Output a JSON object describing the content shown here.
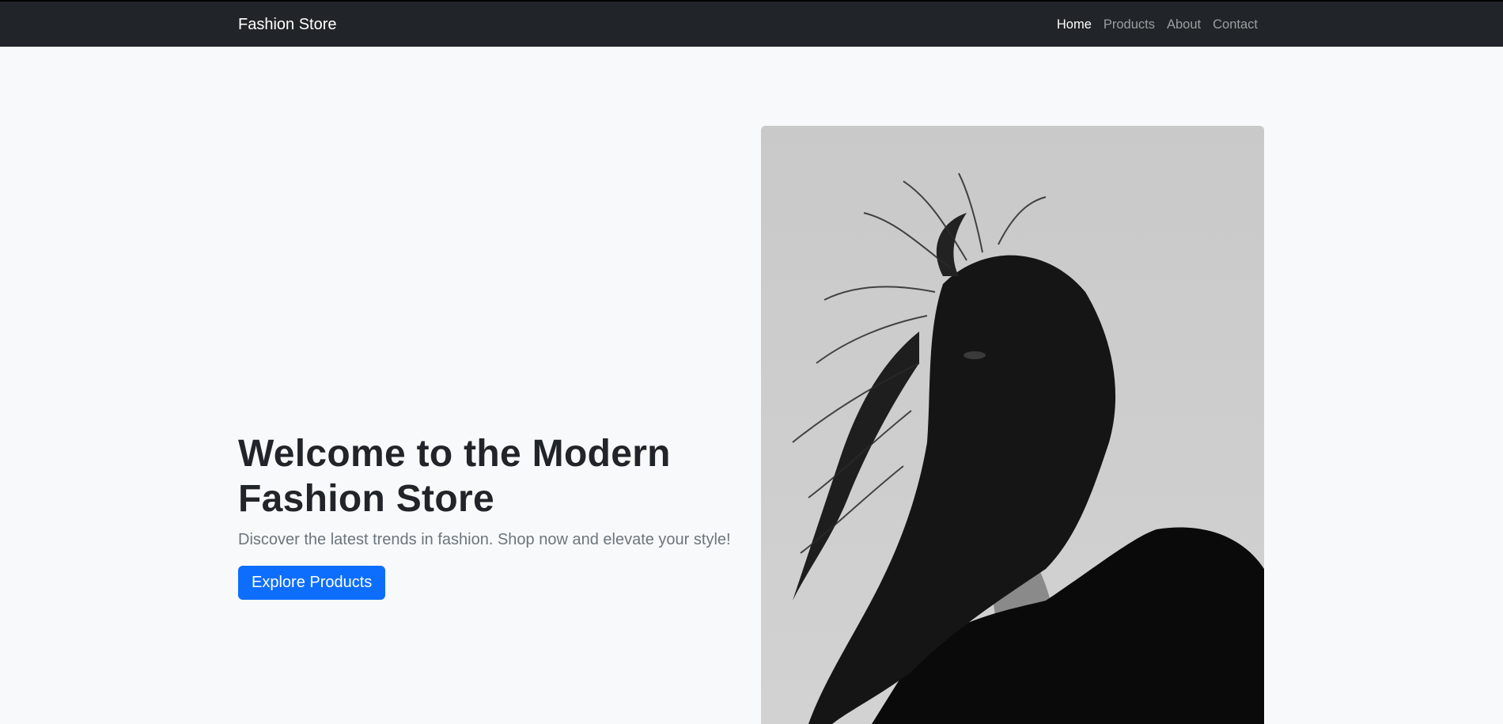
{
  "navbar": {
    "brand": "Fashion Store",
    "links": [
      {
        "label": "Home",
        "active": true
      },
      {
        "label": "Products",
        "active": false
      },
      {
        "label": "About",
        "active": false
      },
      {
        "label": "Contact",
        "active": false
      }
    ]
  },
  "hero": {
    "title": "Welcome to the Modern Fashion Store",
    "subtitle": "Discover the latest trends in fashion. Shop now and elevate your style!",
    "cta_label": "Explore Products"
  },
  "colors": {
    "navbar_bg": "#212529",
    "page_bg": "#f8f9fa",
    "primary": "#0d6efd"
  }
}
